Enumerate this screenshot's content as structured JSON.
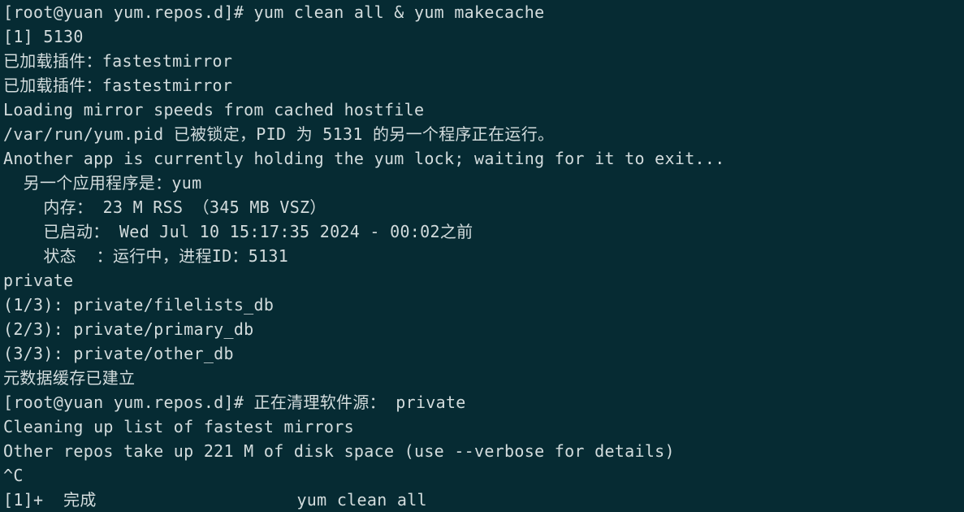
{
  "terminal": {
    "background": "#062b33",
    "foreground": "#d3dcdd",
    "lines": [
      "[root@yuan yum.repos.d]# yum clean all & yum makecache",
      "[1] 5130",
      "已加载插件：fastestmirror",
      "已加载插件：fastestmirror",
      "Loading mirror speeds from cached hostfile",
      "/var/run/yum.pid 已被锁定，PID 为 5131 的另一个程序正在运行。",
      "Another app is currently holding the yum lock; waiting for it to exit...",
      "  另一个应用程序是：yum",
      "    内存： 23 M RSS （345 MB VSZ）",
      "    已启动： Wed Jul 10 15:17:35 2024 - 00:02之前",
      "    状态  ：运行中，进程ID：5131",
      "private",
      "(1/3): private/filelists_db",
      "(2/3): private/primary_db",
      "(3/3): private/other_db",
      "元数据缓存已建立",
      "[root@yuan yum.repos.d]# 正在清理软件源： private",
      "Cleaning up list of fastest mirrors",
      "Other repos take up 221 M of disk space (use --verbose for details)",
      "^C",
      "[1]+  完成                    yum clean all"
    ]
  }
}
